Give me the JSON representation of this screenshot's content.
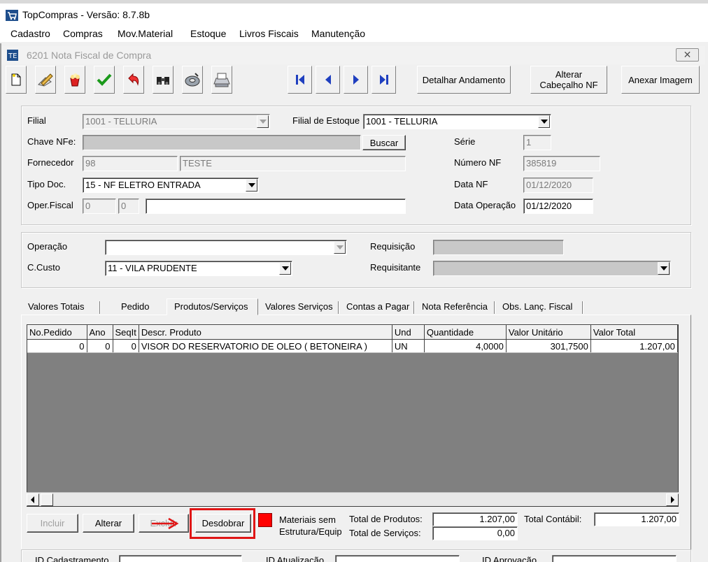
{
  "app": {
    "title": "TopCompras - Versão: 8.7.8b"
  },
  "menu": [
    "Cadastro",
    "Compras",
    "Mov.Material",
    "Estoque",
    "Livros Fiscais",
    "Manutenção"
  ],
  "window": {
    "title": "6201 Nota Fiscal de Compra",
    "close_glyph": "✕"
  },
  "toolbar": {
    "detalhar": "Detalhar Andamento",
    "alterar_line1": "Alterar",
    "alterar_line2": "Cabeçalho NF",
    "anexar": "Anexar Imagem"
  },
  "header": {
    "filial_label": "Filial",
    "filial_value": "1001 - TELLURIA",
    "filial_estoque_label": "Filial de Estoque",
    "filial_estoque_value": "1001 - TELLURIA",
    "chave_label": "Chave NFe:",
    "chave_value": "",
    "buscar": "Buscar",
    "serie_label": "Série",
    "serie_value": "1",
    "fornecedor_label": "Fornecedor",
    "fornecedor_code": "98",
    "fornecedor_name": "TESTE",
    "numero_label": "Número NF",
    "numero_value": "385819",
    "tipo_label": "Tipo Doc.",
    "tipo_value": "15 - NF ELETRO ENTRADA",
    "data_nf_label": "Data NF",
    "data_nf_value": "01/12/2020",
    "oper_label": "Oper.Fiscal",
    "oper_a": "0",
    "oper_b": "0",
    "oper_desc": "",
    "data_op_label": "Data Operação",
    "data_op_value": "01/12/2020"
  },
  "operation": {
    "operacao_label": "Operação",
    "operacao_value": "",
    "requisicao_label": "Requisição",
    "requisicao_value": "",
    "ccusto_label": "C.Custo",
    "ccusto_value": "11 - VILA PRUDENTE",
    "requisitante_label": "Requisitante",
    "requisitante_value": ""
  },
  "tabs": [
    "Valores Totais",
    "Pedido",
    "Produtos/Serviços",
    "Valores Serviços",
    "Contas a Pagar",
    "Nota Referência",
    "Obs. Lanç. Fiscal"
  ],
  "grid": {
    "columns": [
      "No.Pedido",
      "Ano",
      "SeqIt",
      "Descr. Produto",
      "Und",
      "Quantidade",
      "Valor Unitário",
      "Valor Total"
    ],
    "rows": [
      [
        "0",
        "0",
        "0",
        "VISOR DO RESERVATORIO DE OLEO ( BETONEIRA )",
        "UN",
        "4,0000",
        "301,7500",
        "1.207,00"
      ]
    ]
  },
  "actions": {
    "incluir": "Incluir",
    "alterar": "Alterar",
    "excluir": "Excluir",
    "desdobrar": "Desdobrar",
    "materiais_line1": "Materiais sem",
    "materiais_line2": "Estrutura/Equip"
  },
  "totals": {
    "produtos_label": "Total de Produtos:",
    "produtos_value": "1.207,00",
    "servicos_label": "Total de Serviços:",
    "servicos_value": "0,00",
    "contabil_label": "Total Contábil:",
    "contabil_value": "1.207,00"
  },
  "footer": {
    "cadastramento": "ID Cadastramento",
    "atualizacao": "ID Atualização",
    "aprovacao": "ID Aprovação"
  },
  "colors": {
    "highlight": "#e01515",
    "legend_red": "#ff0000",
    "nav_blue": "#1f3fbf"
  }
}
